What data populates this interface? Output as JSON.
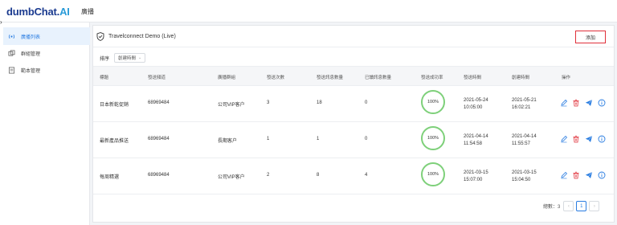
{
  "app": {
    "logo_main": "dumbChat.",
    "logo_ai": "AI",
    "page_heading": "廣播"
  },
  "sidebar": {
    "items": [
      {
        "label": "廣播列表",
        "icon": "broadcast-icon",
        "active": true
      },
      {
        "label": "群組管理",
        "icon": "group-icon",
        "active": false
      },
      {
        "label": "範本管理",
        "icon": "template-icon",
        "active": false
      }
    ]
  },
  "card": {
    "title": "Travelconnect Demo (Live)",
    "add_label": "添加",
    "sort_label": "排序",
    "sort_value": "創建時間"
  },
  "table": {
    "columns": [
      "標題",
      "發送頻道",
      "廣播群組",
      "發送次數",
      "發送訊息數量",
      "已讀訊息數量",
      "發送成功率",
      "發送時間",
      "創建時間",
      "操作"
    ],
    "rows": [
      {
        "title": "日本新乾促銷",
        "channel": "68969484",
        "group": "公司VIP客户",
        "send_count": "3",
        "msg_count": "18",
        "read_count": "0",
        "success_rate": "100%",
        "send_date": "2021-05-24",
        "send_time": "10:05:00",
        "create_date": "2021-05-21",
        "create_time": "16:02:21"
      },
      {
        "title": "最新產品推送",
        "channel": "68969484",
        "group": "長期客户",
        "send_count": "1",
        "msg_count": "1",
        "read_count": "0",
        "success_rate": "100%",
        "send_date": "2021-04-14",
        "send_time": "11:54:58",
        "create_date": "2021-04-14",
        "create_time": "11:55:57"
      },
      {
        "title": "每周精選",
        "channel": "68969484",
        "group": "公司VIP客户",
        "send_count": "2",
        "msg_count": "8",
        "read_count": "4",
        "success_rate": "100%",
        "send_date": "2021-03-15",
        "send_time": "15:07:00",
        "create_date": "2021-03-15",
        "create_time": "15:04:50"
      }
    ]
  },
  "pagination": {
    "total_label": "總數：3",
    "prev": "‹",
    "current_page": "1",
    "next": "›"
  },
  "colors": {
    "brand": "#1a3a8f",
    "accent": "#2a7de1",
    "success_ring": "#7ed07a",
    "danger": "#e0303a"
  }
}
